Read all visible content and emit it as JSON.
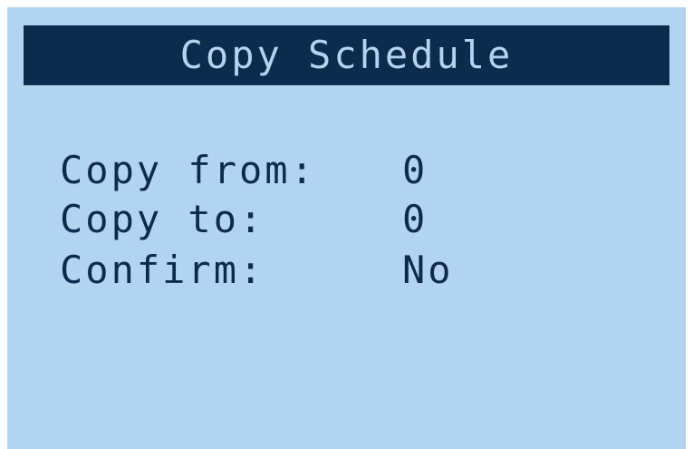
{
  "screen": {
    "title": "Copy Schedule",
    "background_color": "#b3d4ef",
    "title_bar_color": "#0d2b4c",
    "fields": [
      {
        "label": "Copy from:",
        "value": "0"
      },
      {
        "label": "Copy to:",
        "value": "0"
      },
      {
        "label": "Confirm:",
        "value": "No"
      }
    ]
  }
}
